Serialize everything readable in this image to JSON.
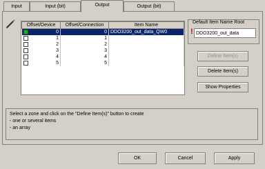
{
  "tabs": [
    "Input",
    "Input (bit)",
    "Output",
    "Output (bit)"
  ],
  "active_tab": "Output",
  "table": {
    "headers": [
      "Offset/Device",
      "Offset/Connection",
      "Item Name"
    ],
    "rows": [
      {
        "device": "0",
        "connection": "0",
        "name": "DDO3200_out_data_QW0",
        "checked": true,
        "selected": true
      },
      {
        "device": "1",
        "connection": "1",
        "name": "",
        "checked": false,
        "selected": false
      },
      {
        "device": "2",
        "connection": "2",
        "name": "",
        "checked": false,
        "selected": false
      },
      {
        "device": "3",
        "connection": "3",
        "name": "",
        "checked": false,
        "selected": false
      },
      {
        "device": "4",
        "connection": "4",
        "name": "",
        "checked": false,
        "selected": false
      },
      {
        "device": "5",
        "connection": "5",
        "name": "",
        "checked": false,
        "selected": false
      }
    ]
  },
  "default_item": {
    "title": "Default Item Name Root",
    "value": "DDO3200_out_data"
  },
  "buttons": {
    "define": "Define Item(s)",
    "delete": "Delete Item(s)",
    "show": "Show Properties",
    "ok": "OK",
    "cancel": "Cancel",
    "apply": "Apply"
  },
  "help": {
    "line1": "Select a zone and click on the \"Define Item(s)\" button to create",
    "line2": "- one or several items",
    "line3": "- an array"
  },
  "colors": {
    "selection": "#0a246a",
    "checked": "#00c000",
    "warning": "#c00000"
  }
}
